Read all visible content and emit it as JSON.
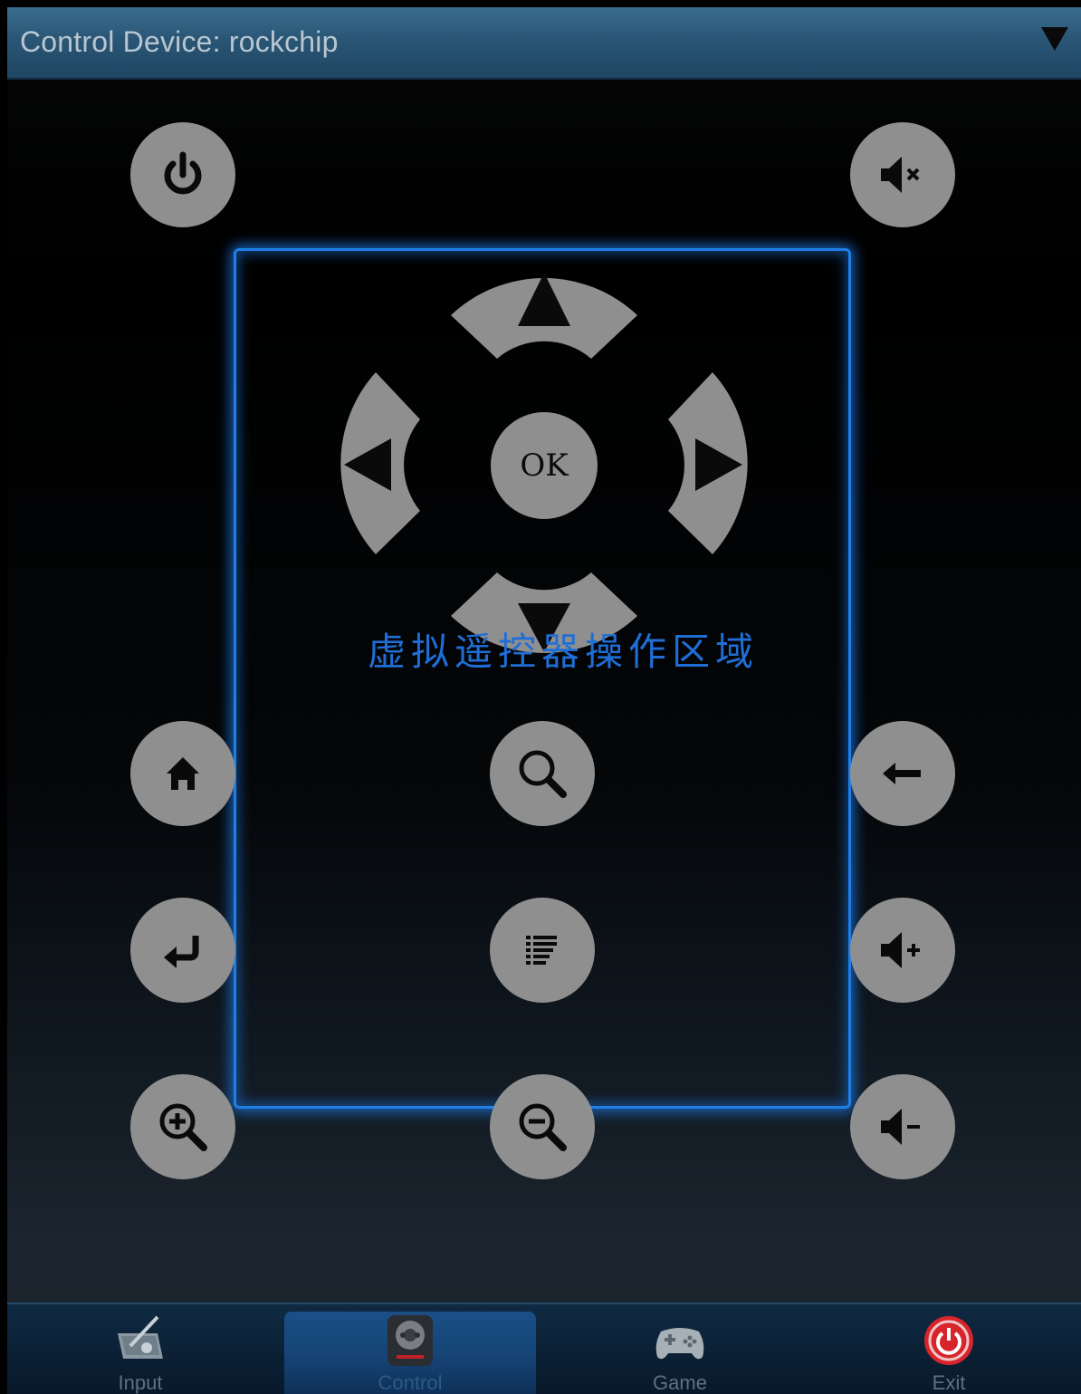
{
  "device_selector": {
    "label": "Control Device: rockchip",
    "icon": "dropdown-caret-icon"
  },
  "control_area": {
    "label": "虚拟遥控器操作区域",
    "frame_color": "#1f7fe6",
    "ok_label": "OK"
  },
  "buttons": {
    "power": "power-icon",
    "mute": "mute-icon",
    "home": "home-icon",
    "search": "search-icon",
    "back": "back-arrow-icon",
    "enter": "enter-icon",
    "menu": "menu-list-icon",
    "volume_up": "volume-up-icon",
    "zoom_in": "zoom-in-icon",
    "zoom_out": "zoom-out-icon",
    "volume_down": "volume-down-icon"
  },
  "tabs": [
    {
      "label": "Input",
      "icon": "input-tablet-icon",
      "active": false
    },
    {
      "label": "Control",
      "icon": "remote-control-icon",
      "active": true
    },
    {
      "label": "Game",
      "icon": "gamepad-icon",
      "active": false
    },
    {
      "label": "Exit",
      "icon": "exit-power-icon",
      "active": false
    }
  ],
  "colors": {
    "accent": "#1f7fe6",
    "button_gray": "#8f8f8f",
    "header": "#2a5676",
    "exit_red": "#d8252b"
  }
}
